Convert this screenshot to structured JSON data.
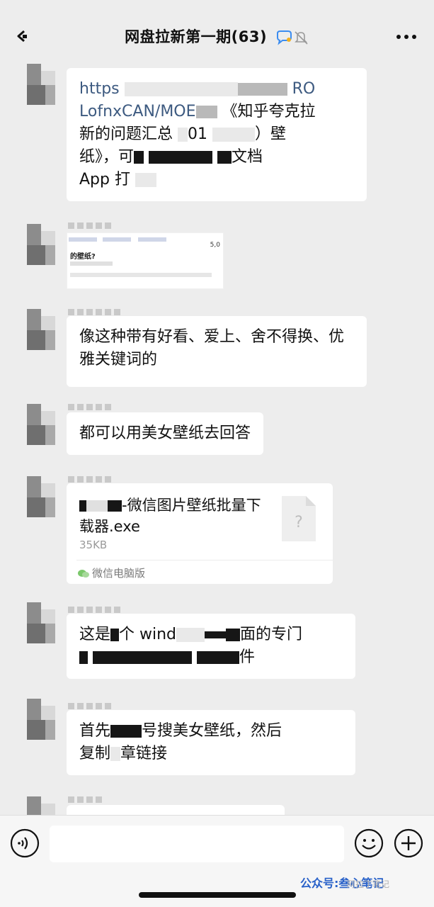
{
  "header": {
    "title": "网盘拉新第一期(63)"
  },
  "messages": {
    "m1": {
      "line1": "https",
      "line1_tail": "RO",
      "line2": "LofnxCAN/MOE",
      "line2_tail": "《知乎夸克拉",
      "line3": "新的问题汇总",
      "line3_mid": "01",
      "line3_tail": "）壁",
      "line4": "纸》，可",
      "line4_tail": "文档",
      "line5": "App 打"
    },
    "m2": {
      "image_title": "的壁纸?",
      "image_number": "5,0"
    },
    "m3": {
      "text": "像这种带有好看、爱上、舍不得换、优雅关键词的"
    },
    "m4": {
      "text": "都可以用美女壁纸去回答"
    },
    "m5": {
      "file_name_tail": "-微信图片壁纸批量下载器.exe",
      "file_size": "35KB",
      "file_icon_glyph": "?",
      "source": "微信电脑版"
    },
    "m6": {
      "line1_start": "这是",
      "line1_mid": "个 wind",
      "line1_tail": "面的专门",
      "line2_tail": "件"
    },
    "m7": {
      "line1_start": "首先",
      "line1_mid": "号搜",
      "line1_tail": "美女壁纸，然后",
      "line2_start": "复制",
      "line2_tail": "章链接"
    }
  },
  "input_bar": {
    "placeholder": ""
  },
  "watermark": {
    "text": "公众号:叁心笔记",
    "sub": "阿拉丁笔记"
  },
  "colors": {
    "background": "#ededed",
    "bubble": "#ffffff",
    "link": "#3d5a80",
    "watermark": "#2a62c9"
  },
  "icons": [
    "back-icon",
    "chat-bubble-icon",
    "mute-bell-icon",
    "more-icon",
    "voice-icon",
    "emoji-icon",
    "plus-icon",
    "file-icon",
    "wechat-icon"
  ]
}
